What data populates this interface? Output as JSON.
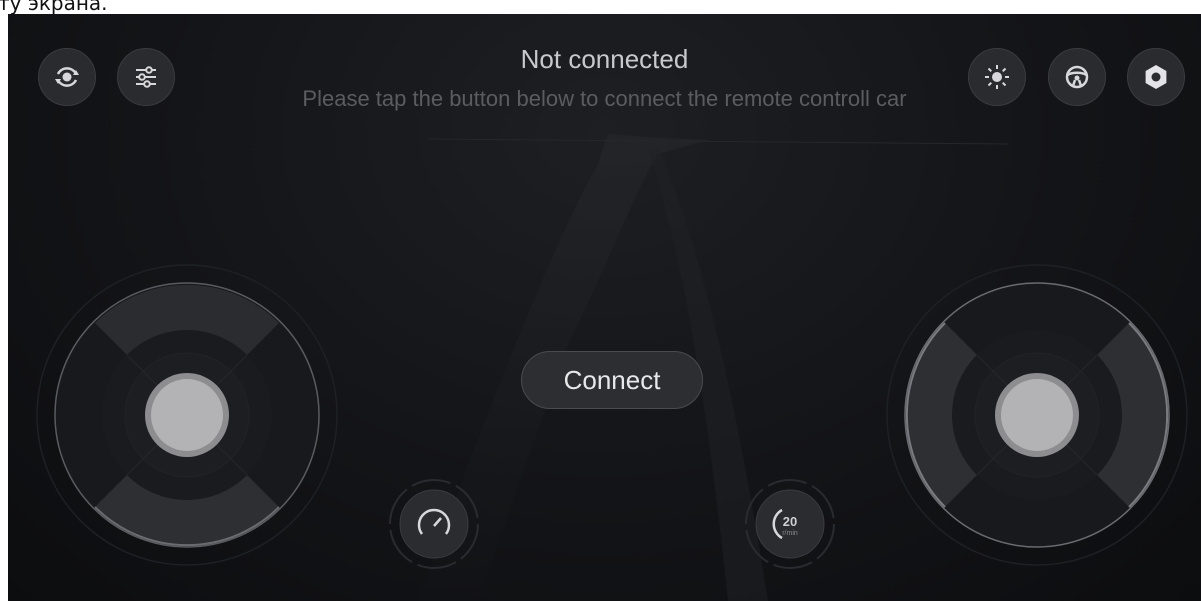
{
  "top_fragment": "ту экрана.",
  "status": {
    "title": "Not connected",
    "subtitle": "Please tap the button below to connect the remote controll car"
  },
  "connect_button": {
    "label": "Connect"
  },
  "toolbar_left": [
    {
      "icon": "rotate-view-icon"
    },
    {
      "icon": "sliders-icon"
    }
  ],
  "toolbar_right": [
    {
      "icon": "light-icon"
    },
    {
      "icon": "steering-wheel-icon"
    },
    {
      "icon": "settings-icon"
    }
  ],
  "rpm": {
    "value": "20",
    "unit": "r/min"
  },
  "colors": {
    "background": "#131417",
    "button": "#2a2b2f",
    "text_primary": "#c9c9cc",
    "text_secondary": "#5b5c60"
  }
}
